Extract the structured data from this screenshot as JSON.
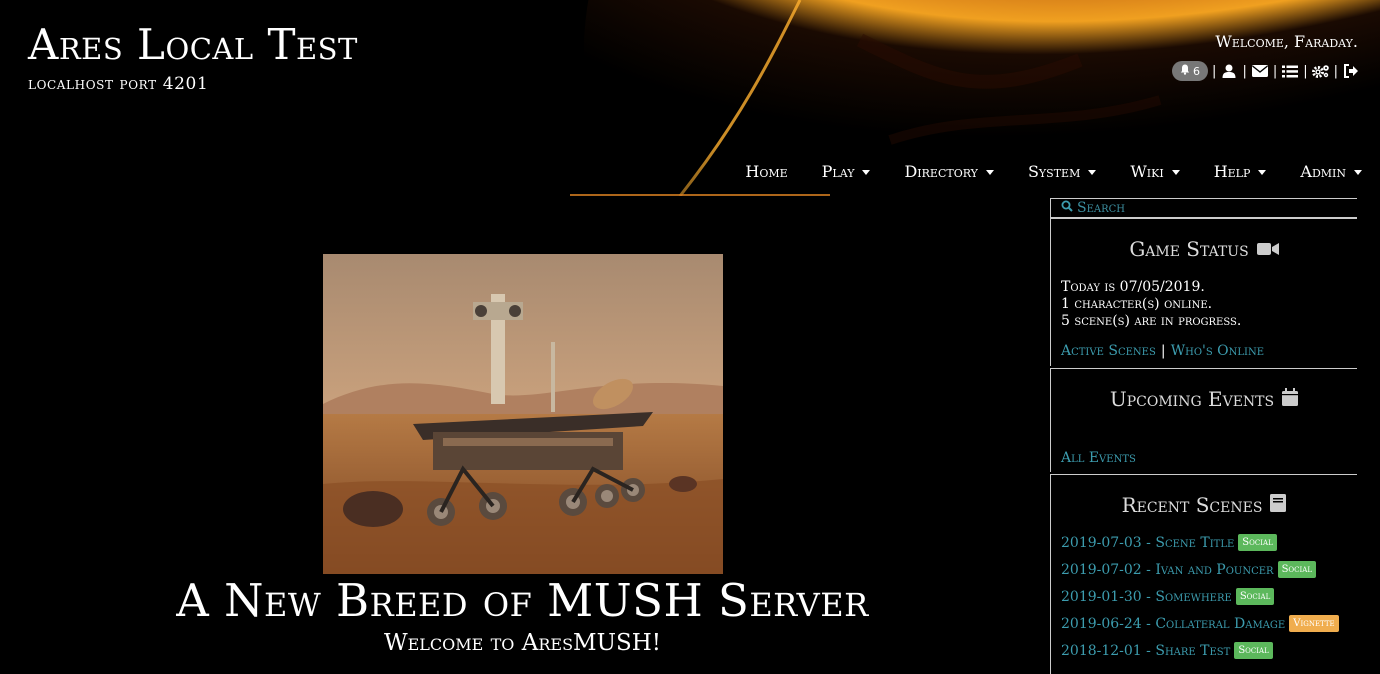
{
  "site": {
    "title": "Ares Local Test",
    "subtitle": "localhost port 4201"
  },
  "user": {
    "welcome": "Welcome, Faraday.",
    "notification_count": "6",
    "icons": [
      "bell-icon",
      "user-icon",
      "envelope-icon",
      "list-icon",
      "cogs-icon",
      "logout-icon"
    ]
  },
  "nav": {
    "items": [
      {
        "label": "Home",
        "dropdown": false
      },
      {
        "label": "Play",
        "dropdown": true
      },
      {
        "label": "Directory",
        "dropdown": true
      },
      {
        "label": "System",
        "dropdown": true
      },
      {
        "label": "Wiki",
        "dropdown": true
      },
      {
        "label": "Help",
        "dropdown": true
      },
      {
        "label": "Admin",
        "dropdown": true
      }
    ]
  },
  "main": {
    "hero_title": "A New Breed of MUSH Server",
    "hero_subtitle": "Welcome to AresMUSH!"
  },
  "sidebar": {
    "search_placeholder": "Search",
    "game_status": {
      "title": "Game Status",
      "lines": [
        "Today is 07/05/2019.",
        "1 character(s) online.",
        "5 scene(s) are in progress."
      ],
      "links": [
        "Active Scenes",
        "Who's Online"
      ]
    },
    "upcoming_events": {
      "title": "Upcoming Events",
      "link": "All Events"
    },
    "recent_scenes": {
      "title": "Recent Scenes",
      "items": [
        {
          "label": "2019-07-03 - Scene Title",
          "tag": "Social",
          "tag_color": "#5cb85c"
        },
        {
          "label": "2019-07-02 - Ivan and Pouncer",
          "tag": "Social",
          "tag_color": "#5cb85c"
        },
        {
          "label": "2019-01-30 - Somewhere",
          "tag": "Social",
          "tag_color": "#5cb85c"
        },
        {
          "label": "2019-06-24 - Collateral Damage",
          "tag": "Vignette",
          "tag_color": "#f0ad4e"
        },
        {
          "label": "2018-12-01 - Share Test",
          "tag": "Social",
          "tag_color": "#5cb85c"
        }
      ]
    }
  },
  "colors": {
    "link": "#3c9cae",
    "background": "#000000"
  }
}
